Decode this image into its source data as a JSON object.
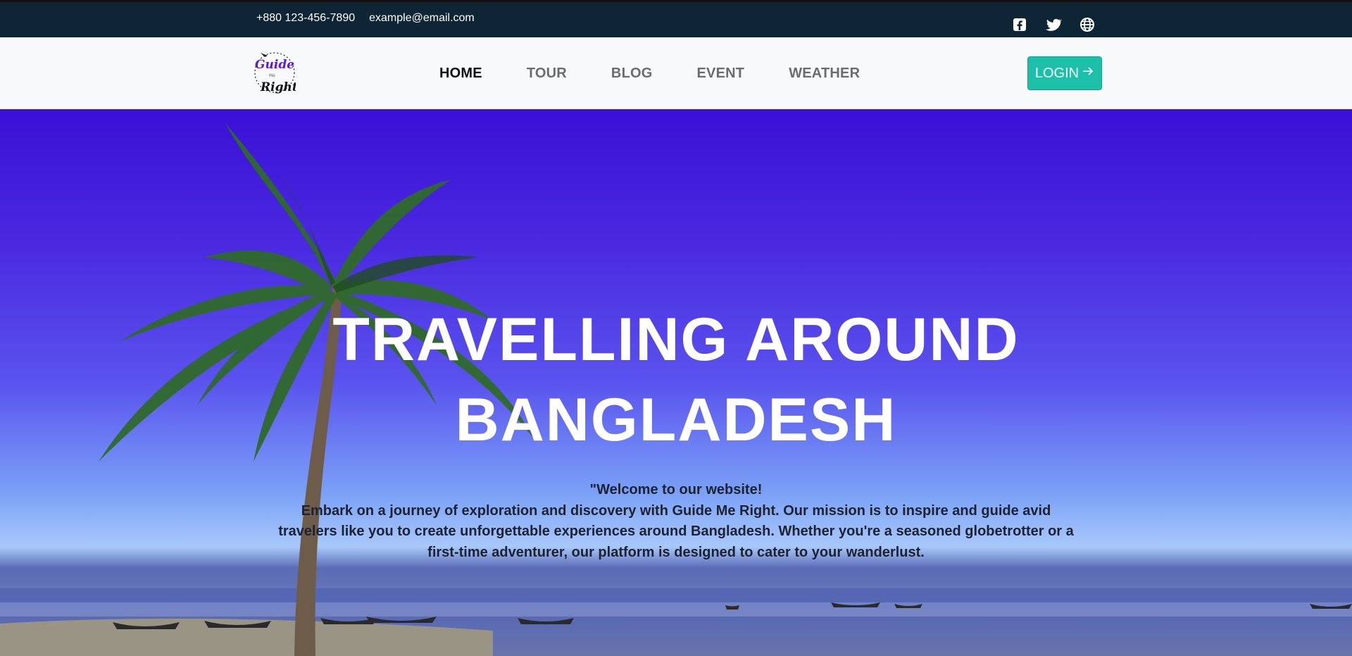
{
  "topbar": {
    "phone": "+880 123-456-7890",
    "email": "example@email.com",
    "social_icons": [
      "facebook-square-icon",
      "twitter-icon",
      "globe-icon"
    ]
  },
  "navbar": {
    "logo": {
      "line1": "Guide",
      "line2": "Me",
      "line3": "Right"
    },
    "links": [
      {
        "label": "HOME",
        "active": true
      },
      {
        "label": "TOUR",
        "active": false
      },
      {
        "label": "BLOG",
        "active": false
      },
      {
        "label": "EVENT",
        "active": false
      },
      {
        "label": "WEATHER",
        "active": false
      }
    ],
    "login_label": "LOGIN",
    "login_icon": "arrow-right-icon"
  },
  "hero": {
    "title_line1": "TRAVELLING AROUND",
    "title_line2": "BANGLADESH",
    "welcome": "\"Welcome to our website!",
    "description": "Embark on a journey of exploration and discovery with Guide Me Right. Our mission is to inspire and guide avid travelers like you to create unforgettable experiences around Bangladesh. Whether you're a seasoned globetrotter or a first-time adventurer, our platform is designed to cater to your wanderlust."
  },
  "colors": {
    "topbar_bg": "#0d2534",
    "navbar_bg": "#f8f9fa",
    "login_button": "#1cbfa8",
    "hero_sky": "#4a2ae0",
    "nav_active": "#111111",
    "nav_inactive": "#6c6c6c"
  }
}
